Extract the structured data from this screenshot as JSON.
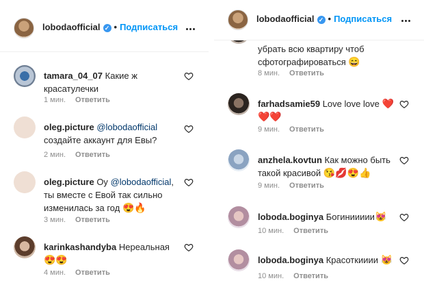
{
  "left": {
    "header": {
      "username": "lobodaofficial",
      "follow_label": "Подписаться",
      "separator": "•"
    },
    "comments": [
      {
        "author": "tamara_04_07",
        "text": "Какие ж красатулечки",
        "time": "1 мин.",
        "reply": "Ответить"
      },
      {
        "author": "oleg.picture",
        "mention": "@lobodaofficial",
        "text": "создайте аккаунт для Евы?",
        "time": "2 мин.",
        "reply": "Ответить"
      },
      {
        "author": "oleg.picture",
        "text_pre": "Оу",
        "mention": "@lobodaofficial",
        "text": ", ты вместе с Евой так сильно изменилась за год",
        "emoji": "😍🔥",
        "time": "3 мин.",
        "reply": "Ответить"
      },
      {
        "author": "karinkashandyba",
        "text": "Нереальная",
        "emoji": "😍😍",
        "time": "4 мин.",
        "reply": "Ответить"
      }
    ]
  },
  "right": {
    "header": {
      "username": "lobodaofficial",
      "follow_label": "Подписаться",
      "separator": "•"
    },
    "partial": {
      "text": "убрать всю квартиру чтоб сфотографироваться",
      "emoji": "😄",
      "time": "8 мин.",
      "reply": "Ответить"
    },
    "comments": [
      {
        "author": "farhadsamie59",
        "text": "Love love love",
        "emoji": "❤️❤️❤️",
        "time": "9 мин.",
        "reply": "Ответить"
      },
      {
        "author": "anzhela.kovtun",
        "text": "Как можно быть такой красивой",
        "emoji": "😘💋😍👍",
        "time": "9 мин.",
        "reply": "Ответить"
      },
      {
        "author": "loboda.boginya",
        "text": "Богиниииии",
        "emoji": "😻",
        "time": "10 мин.",
        "reply": "Ответить"
      },
      {
        "author": "loboda.boginya",
        "text": "Красоткииии",
        "emoji": "😻",
        "time": "10 мин.",
        "reply": "Ответить"
      }
    ]
  },
  "icons": {
    "verified": "verified-badge-icon",
    "more": "more-options-icon",
    "like": "heart-outline-icon"
  },
  "colors": {
    "link": "#0095f6",
    "mention": "#00376b",
    "meta": "#8e8e8e",
    "verified": "#3897f0"
  }
}
